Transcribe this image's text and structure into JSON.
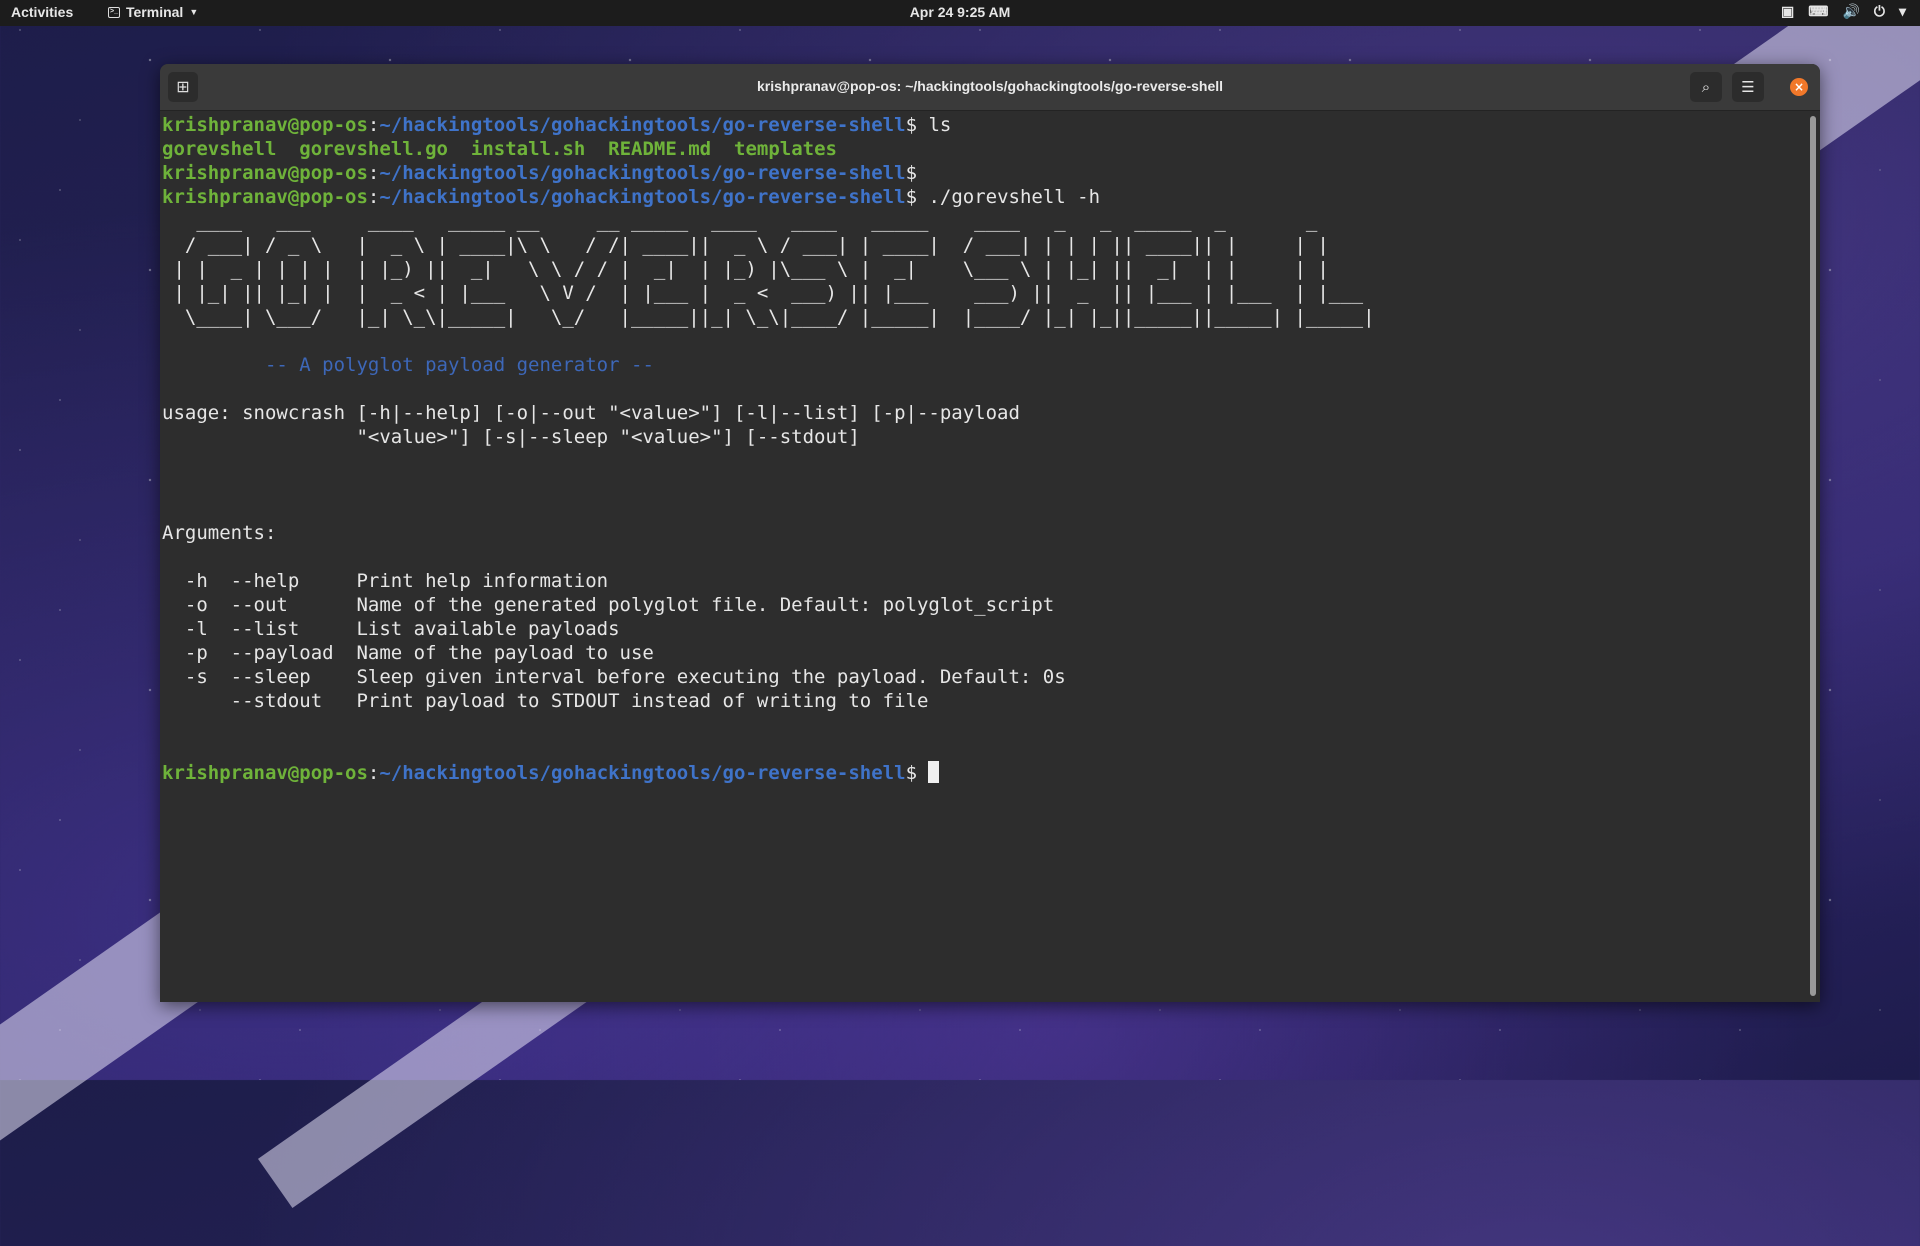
{
  "topbar": {
    "activities": "Activities",
    "app_name": "Terminal",
    "clock": "Apr 24  9:25 AM"
  },
  "window": {
    "title": "krishpranav@pop-os: ~/hackingtools/gohackingtools/go-reverse-shell"
  },
  "prompt": {
    "user": "krishpranav@pop-os",
    "path": "~/hackingtools/gohackingtools/go-reverse-shell"
  },
  "commands": {
    "ls": "ls",
    "help": "./gorevshell -h"
  },
  "files": [
    "gorevshell",
    "gorevshell.go",
    "install.sh",
    "README.md",
    "templates"
  ],
  "banner": [
    "   ____   ___     ____   _____ __     __ _____  ____   ____   _____    ____   _   _  _____  _       _     ",
    "  / ___| / _ \\   |  _ \\ | ____|\\ \\   / /| ____||  _ \\ / ___| | ____|  / ___| | | | || ____|| |     | |    ",
    " | |  _ | | | |  | |_) ||  _|   \\ \\ / / |  _|  | |_) |\\___ \\ |  _|    \\___ \\ | |_| ||  _|  | |     | |    ",
    " | |_| || |_| |  |  _ < | |___   \\ V /  | |___ |  _ <  ___) || |___    ___) ||  _  || |___ | |___  | |___ ",
    "  \\____| \\___/   |_| \\_\\|_____|   \\_/   |_____||_| \\_\\|____/ |_____|  |____/ |_| |_||_____||_____| |_____|"
  ],
  "tagline": "-- A polyglot payload generator --",
  "usage": [
    "usage: snowcrash [-h|--help] [-o|--out \"<value>\"] [-l|--list] [-p|--payload",
    "                 \"<value>\"] [-s|--sleep \"<value>\"] [--stdout]"
  ],
  "arguments_heading": "Arguments:",
  "arguments": [
    "  -h  --help     Print help information",
    "  -o  --out      Name of the generated polyglot file. Default: polyglot_script",
    "  -l  --list     List available payloads",
    "  -p  --payload  Name of the payload to use",
    "  -s  --sleep    Sleep given interval before executing the payload. Default: 0s",
    "      --stdout   Print payload to STDOUT instead of writing to file"
  ],
  "icons": {
    "new_tab": "new-tab-icon",
    "search": "search-icon",
    "menu": "hamburger-menu-icon",
    "close": "close-icon"
  },
  "colors": {
    "prompt_user": "#6fb33a",
    "prompt_path": "#3f73c9",
    "close_button": "#f1782a",
    "terminal_bg": "#2d2d2d"
  }
}
